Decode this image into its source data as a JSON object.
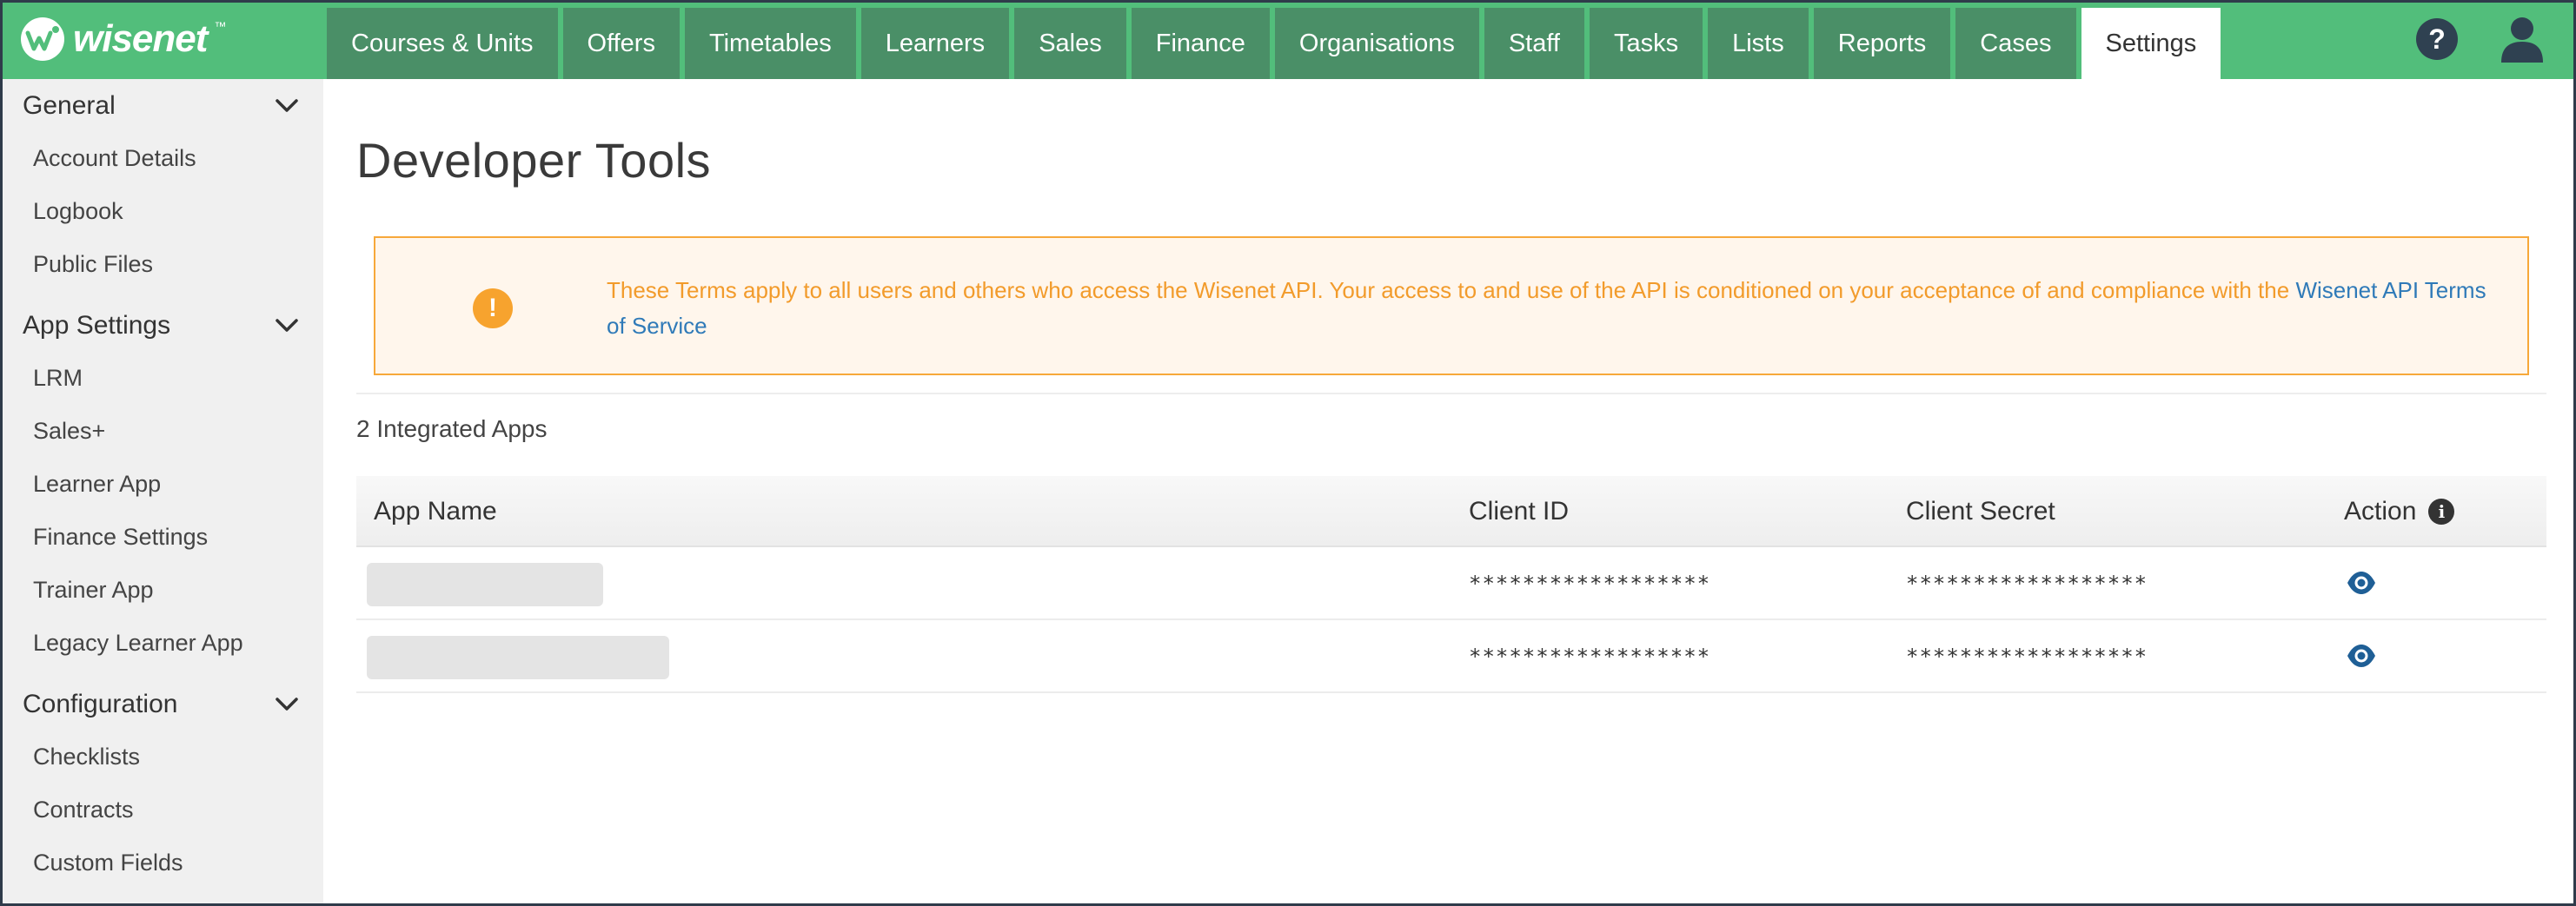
{
  "brand": {
    "name": "wisenet",
    "tm": "™",
    "color": "#52be7b"
  },
  "nav": {
    "tabs": [
      {
        "label": "Courses & Units"
      },
      {
        "label": "Offers"
      },
      {
        "label": "Timetables"
      },
      {
        "label": "Learners"
      },
      {
        "label": "Sales"
      },
      {
        "label": "Finance"
      },
      {
        "label": "Organisations"
      },
      {
        "label": "Staff"
      },
      {
        "label": "Tasks"
      },
      {
        "label": "Lists"
      },
      {
        "label": "Reports"
      },
      {
        "label": "Cases"
      },
      {
        "label": "Settings",
        "active": true
      }
    ],
    "help_glyph": "?",
    "icons": {
      "help": "help-icon",
      "user": "user-icon"
    }
  },
  "sidebar": {
    "sections": [
      {
        "title": "General",
        "items": [
          "Account Details",
          "Logbook",
          "Public Files"
        ]
      },
      {
        "title": "App Settings",
        "items": [
          "LRM",
          "Sales+",
          "Learner App",
          "Finance Settings",
          "Trainer App",
          "Legacy Learner App"
        ]
      },
      {
        "title": "Configuration",
        "items": [
          "Checklists",
          "Contracts",
          "Custom Fields"
        ]
      }
    ]
  },
  "main": {
    "title": "Developer Tools",
    "notice": {
      "icon_glyph": "!",
      "text": "These Terms apply to all users and others who access the Wisenet API. Your access to and use of the API is conditioned on your acceptance of and compliance with the ",
      "link_text": "Wisenet API Terms of Service",
      "color": "#f29b2b"
    },
    "integrated_count_label": "2 Integrated Apps",
    "table": {
      "headers": {
        "app_name": "App Name",
        "client_id": "Client ID",
        "client_secret": "Client Secret",
        "action": "Action"
      },
      "action_info_glyph": "i",
      "rows": [
        {
          "client_id": "******************",
          "client_secret": "******************"
        },
        {
          "client_id": "******************",
          "client_secret": "******************"
        }
      ]
    }
  }
}
